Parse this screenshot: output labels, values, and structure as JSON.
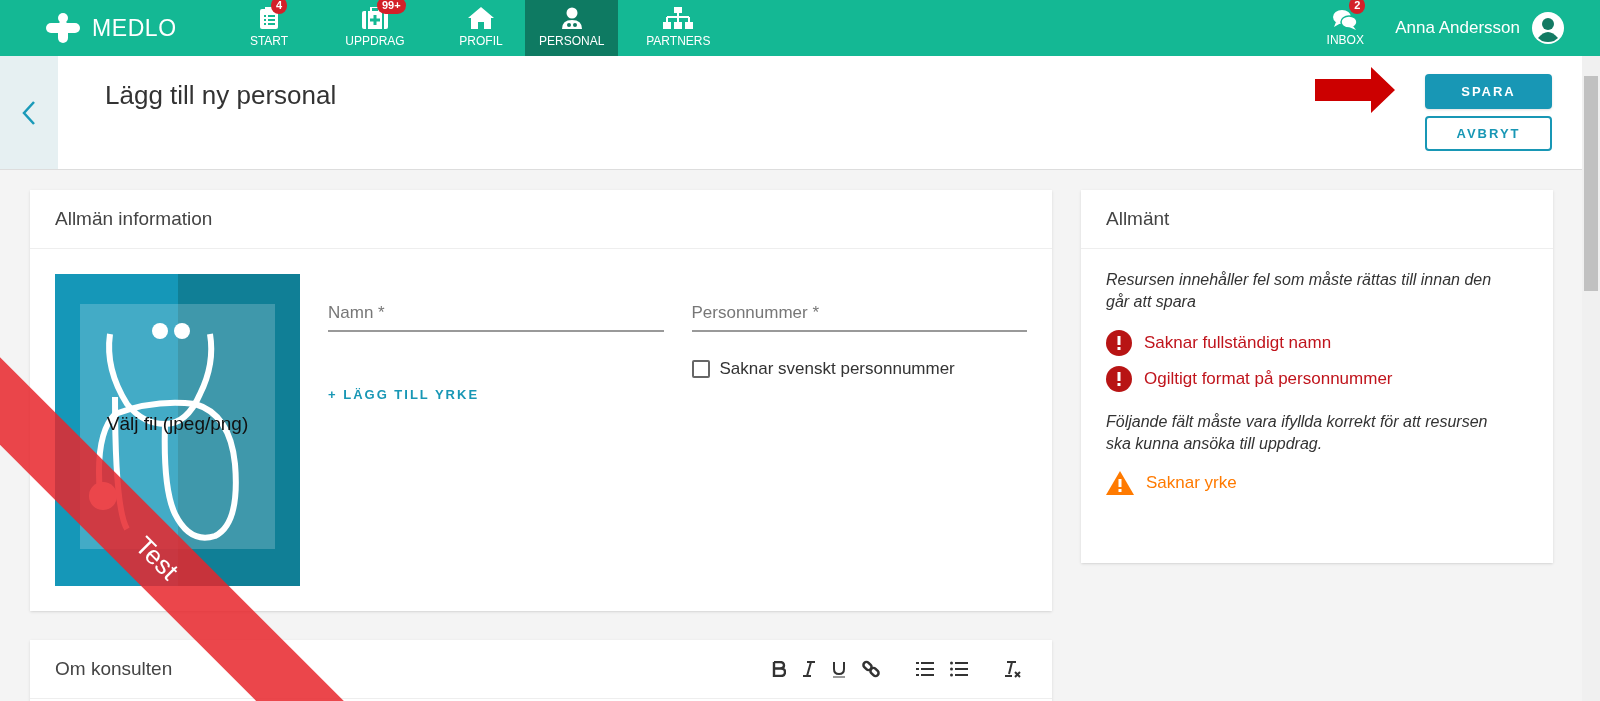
{
  "nav": {
    "logo": "MEDLO",
    "items": [
      {
        "label": "START",
        "badge": "4",
        "selected": false
      },
      {
        "label": "UPPDRAG",
        "badge": "99+",
        "selected": false
      },
      {
        "label": "PROFIL",
        "selected": false
      },
      {
        "label": "PERSONAL",
        "selected": true
      },
      {
        "label": "PARTNERS",
        "selected": false
      }
    ],
    "inbox": {
      "label": "INBOX",
      "badge": "2"
    },
    "user": "Anna Andersson"
  },
  "page": {
    "title": "Lägg till ny personal",
    "save": "SPARA",
    "cancel": "AVBRYT"
  },
  "general": {
    "title": "Allmän information",
    "image_label": "Välj fil (jpeg/png)",
    "fields": [
      {
        "placeholder": "Namn *"
      },
      {
        "placeholder": "Personnummer *"
      }
    ],
    "checkbox": {
      "label": "Saknar svenskt personnummer",
      "checked": false
    },
    "add_link": "+ LÄGG TILL YRKE"
  },
  "summary": {
    "title": "Allmänt",
    "items": [
      {
        "kind": "paragraph",
        "text": "Resursen innehåller fel som måste rättas till innan den går att spara"
      },
      {
        "kind": "error",
        "text": "Saknar fullständigt namn"
      },
      {
        "kind": "error",
        "text": "Ogiltigt format på personnummer"
      },
      {
        "kind": "paragraph",
        "text": "Följande fält måste vara ifyllda korrekt för att resursen ska kunna ansöka till uppdrag."
      },
      {
        "kind": "warning",
        "text": "Saknar yrke"
      }
    ]
  },
  "about": {
    "title": "Om konsulten"
  },
  "ribbon": "Test"
}
